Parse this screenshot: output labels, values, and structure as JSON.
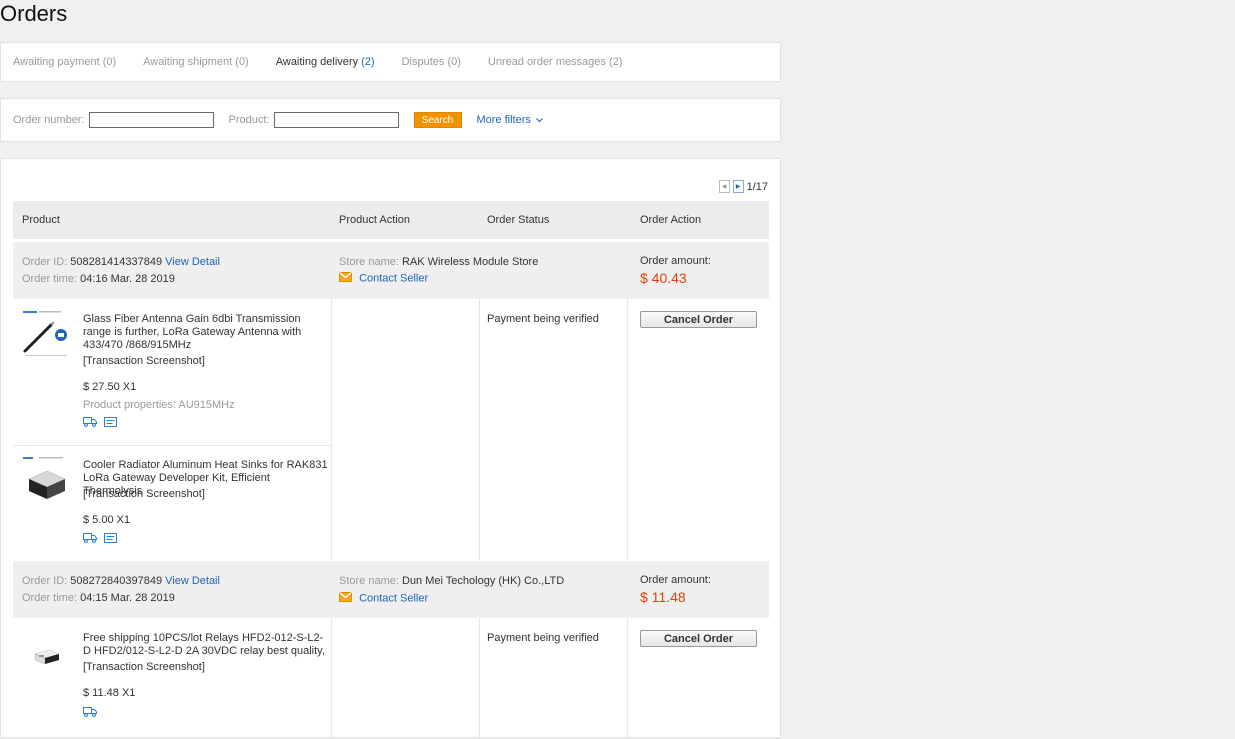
{
  "page_title": "Orders",
  "tabs": [
    {
      "label": "Awaiting payment",
      "count": "(0)"
    },
    {
      "label": "Awaiting shipment",
      "count": "(0)"
    },
    {
      "label": "Awaiting delivery",
      "count": "(2)"
    },
    {
      "label": "Disputes",
      "count": "(0)"
    },
    {
      "label": "Unread order messages",
      "count": "(2)"
    }
  ],
  "filters": {
    "order_number_label": "Order number:",
    "order_number_value": "",
    "product_label": "Product:",
    "product_value": "",
    "search_label": "Search",
    "more_filters_label": "More filters",
    "more_filters_icon": "chevron-down-icon"
  },
  "pager": {
    "text": "1/17",
    "prev_icon": "chevron-left-icon",
    "next_icon": "chevron-right-icon"
  },
  "table_headers": {
    "product": "Product",
    "product_action": "Product Action",
    "order_status": "Order Status",
    "order_action": "Order Action"
  },
  "colors": {
    "accent": "#1f64b8",
    "search_button": "#f39200",
    "amount": "#e2400a"
  },
  "orders": [
    {
      "order_id_label": "Order ID:",
      "order_id": "508281414337849",
      "view_detail": "View Detail",
      "order_time_label": "Order time:",
      "order_time": "04:16 Mar. 28 2019",
      "store_label": "Store name:",
      "store_name": "RAK Wireless Module Store",
      "contact_seller": "Contact Seller",
      "amount_label": "Order amount:",
      "amount": "$ 40.43",
      "status": "Payment being verified",
      "cancel_label": "Cancel Order",
      "items": [
        {
          "title": "Glass Fiber Antenna Gain 6dbi Transmission range is further, LoRa Gateway Antenna with 433/470 /868/915MHz",
          "screenshot": "[Transaction Screenshot]",
          "price": "$ 27.50 X1",
          "properties": "Product properties: AU915MHz"
        },
        {
          "title": "Cooler Radiator Aluminum Heat Sinks for RAK831 LoRa Gateway Developer Kit, Efficient Thermolysis",
          "screenshot": "[Transaction Screenshot]",
          "price": "$ 5.00 X1"
        }
      ]
    },
    {
      "order_id_label": "Order ID:",
      "order_id": "508272840397849",
      "view_detail": "View Detail",
      "order_time_label": "Order time:",
      "order_time": "04:15 Mar. 28 2019",
      "store_label": "Store name:",
      "store_name": "Dun Mei Techology (HK) Co.,LTD",
      "contact_seller": "Contact Seller",
      "amount_label": "Order amount:",
      "amount": "$ 11.48",
      "status": "Payment being verified",
      "cancel_label": "Cancel Order",
      "items": [
        {
          "title": "Free shipping 10PCS/lot Relays HFD2-012-S-L2-D HFD2/012-S-L2-D 2A 30VDC relay best quality,",
          "screenshot": "[Transaction Screenshot]",
          "price": "$ 11.48 X1"
        }
      ]
    }
  ]
}
